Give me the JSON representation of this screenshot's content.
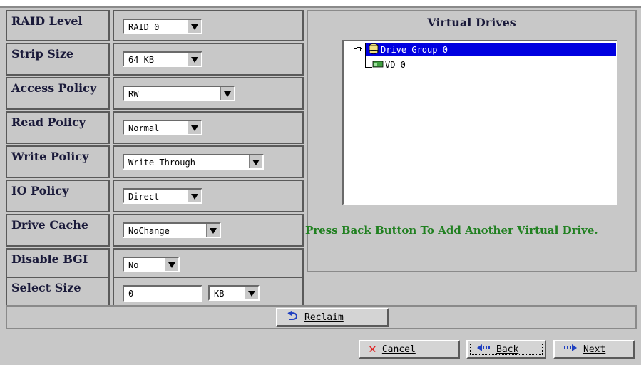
{
  "form": {
    "raid_level": {
      "label": "RAID Level",
      "value": "RAID 0"
    },
    "strip_size": {
      "label": "Strip Size",
      "value": "64 KB"
    },
    "access_policy": {
      "label": "Access Policy",
      "value": "RW"
    },
    "read_policy": {
      "label": "Read Policy",
      "value": "Normal"
    },
    "write_policy": {
      "label": "Write Policy",
      "value": "Write Through"
    },
    "io_policy": {
      "label": "IO Policy",
      "value": "Direct"
    },
    "drive_cache": {
      "label": "Drive Cache",
      "value": "NoChange"
    },
    "disable_bgi": {
      "label": "Disable BGI",
      "value": "No"
    },
    "select_size": {
      "label": "Select Size",
      "value": "0",
      "unit": "KB"
    }
  },
  "virtual_drives": {
    "title": "Virtual Drives",
    "tree": [
      {
        "label": "Drive Group 0",
        "selected": true
      },
      {
        "label": "VD 0",
        "selected": false
      }
    ],
    "hint": "Press Back Button To Add Another Virtual Drive."
  },
  "buttons": {
    "reclaim": "Reclaim",
    "cancel": "Cancel",
    "back": "Back",
    "next": "Next"
  },
  "colors": {
    "background": "#c8c8c8",
    "selection": "#0000e0",
    "hint_text": "#208020",
    "cancel_icon": "#e02020",
    "nav_icon": "#2040c0"
  },
  "icons": {
    "drive_group": "database-icon",
    "vd": "virtual-drive-icon",
    "reclaim": "reclaim-icon",
    "cancel": "cancel-x-icon",
    "back": "back-arrow-icon",
    "next": "next-arrow-icon"
  }
}
